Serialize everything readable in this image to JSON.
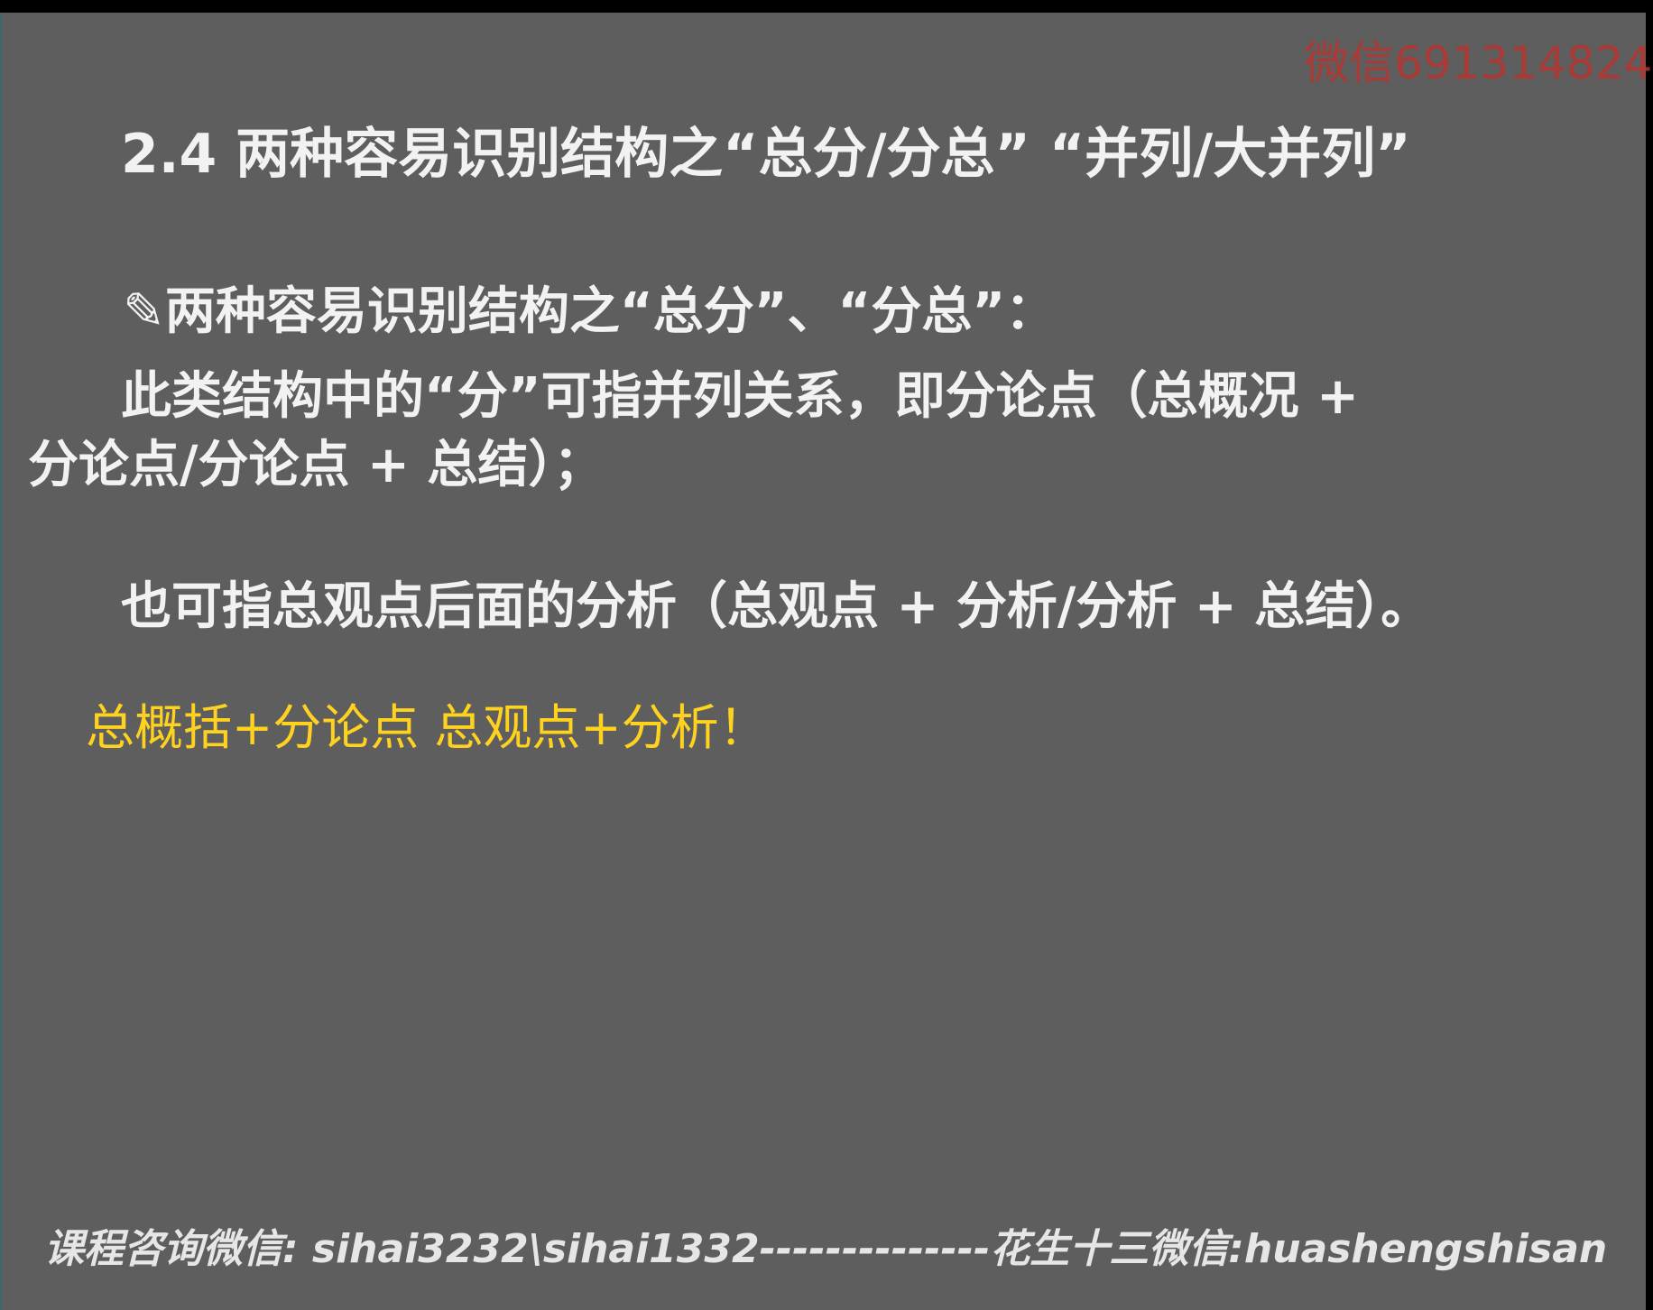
{
  "watermark": "微信691314824",
  "title": "2.4   两种容易识别结构之“总分/分总” “并列/大并列”",
  "subheading": {
    "icon": "pencil-icon",
    "icon_glyph": "✎",
    "text": "两种容易识别结构之“总分”、“分总”："
  },
  "paragraph1": {
    "line1": "此类结构中的“分”可指并列关系，即分论点（总概况 +",
    "line2": "分论点/分论点 + 总结）；"
  },
  "paragraph2": "也可指总观点后面的分析（总观点 + 分析/分析 + 总结）。",
  "note": "总概括+分论点  总观点+分析！",
  "footer": "课程咨询微信: sihai3232\\sihai1332--------------花生十三微信:huashengshisan",
  "colors": {
    "background": "#5e5e5e",
    "text": "#f2f2f2",
    "note": "#ffd21f",
    "watermark": "#b8342f"
  }
}
